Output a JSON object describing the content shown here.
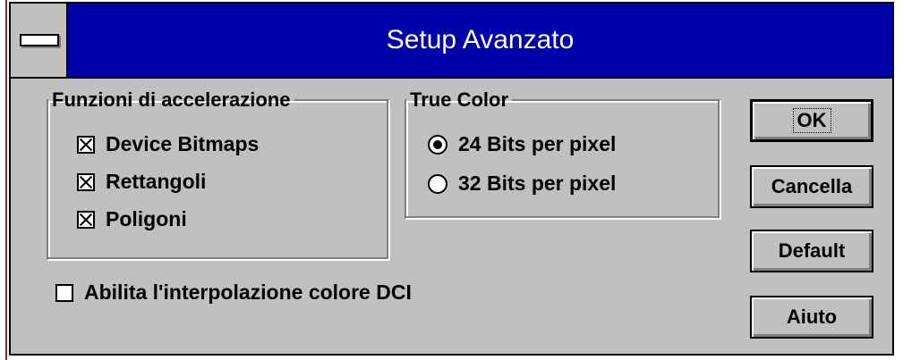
{
  "window": {
    "title": "Setup Avanzato"
  },
  "accel_group": {
    "legend": "Funzioni di accelerazione",
    "options": [
      {
        "label": "Device Bitmaps",
        "checked": true
      },
      {
        "label": "Rettangoli",
        "checked": true
      },
      {
        "label": "Poligoni",
        "checked": true
      }
    ]
  },
  "color_group": {
    "legend": "True Color",
    "options": [
      {
        "label": "24 Bits per pixel",
        "selected": true
      },
      {
        "label": "32 Bits per pixel",
        "selected": false
      }
    ]
  },
  "dci_option": {
    "label": "Abilita l'interpolazione colore DCI",
    "checked": false
  },
  "buttons": {
    "ok": "OK",
    "cancel": "Cancella",
    "default": "Default",
    "help": "Aiuto"
  }
}
